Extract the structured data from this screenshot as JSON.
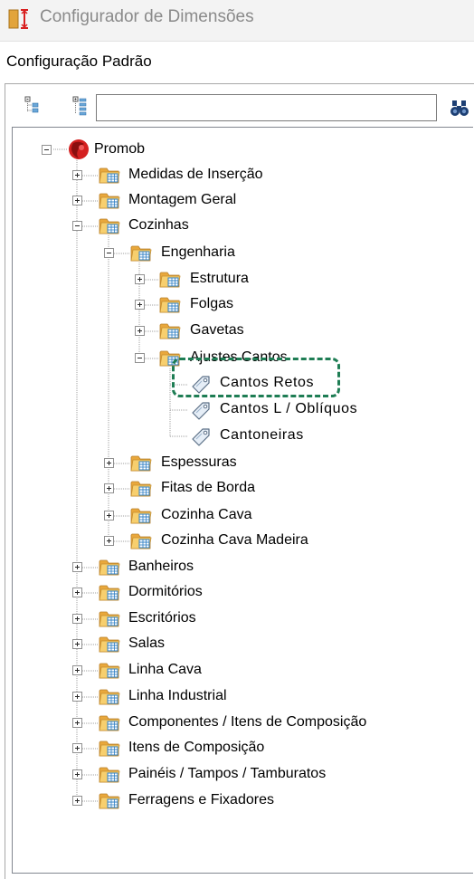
{
  "window": {
    "title": "Configurador de Dimensões"
  },
  "section": {
    "label": "Configuração Padrão"
  },
  "toolbar": {
    "search_value": "",
    "search_placeholder": ""
  },
  "tree": {
    "root": "Promob",
    "nodes": {
      "medidas": "Medidas de Inserção",
      "montagem": "Montagem Geral",
      "cozinhas": "Cozinhas",
      "engenharia": "Engenharia",
      "estrutura": "Estrutura",
      "folgas": "Folgas",
      "gavetas": "Gavetas",
      "ajustes": "Ajustes Cantos",
      "cantos_retos": "Cantos Retos",
      "cantos_l": "Cantos L / Oblíquos",
      "cantoneiras": "Cantoneiras",
      "espessuras": "Espessuras",
      "fitas": "Fitas de Borda",
      "cozinha_cava": "Cozinha Cava",
      "cozinha_cava_madeira": "Cozinha Cava Madeira",
      "banheiros": "Banheiros",
      "dormitorios": "Dormitórios",
      "escritorios": "Escritórios",
      "salas": "Salas",
      "linha_cava": "Linha Cava",
      "linha_industrial": "Linha Industrial",
      "componentes": "Componentes / Itens de Composição",
      "itens": "Itens de Composição",
      "paineis": "Painéis / Tampos / Tamburatos",
      "ferragens": "Ferragens e Fixadores"
    }
  },
  "colors": {
    "highlight": "#1e7d54",
    "folder": "#f4c15a",
    "root_icon": "#d42020"
  }
}
